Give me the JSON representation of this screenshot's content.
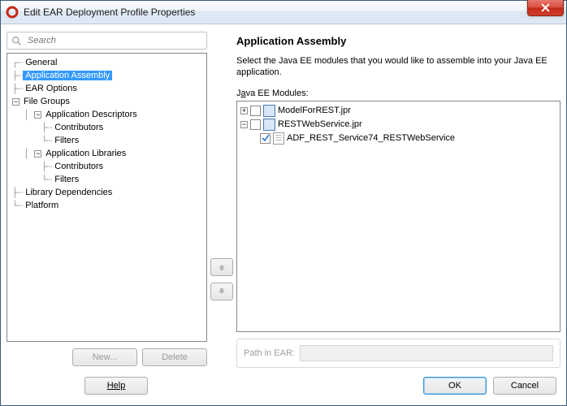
{
  "window": {
    "title": "Edit EAR Deployment Profile Properties"
  },
  "search": {
    "placeholder": "Search"
  },
  "tree": {
    "general": "General",
    "app_assembly": "Application Assembly",
    "ear_options": "EAR Options",
    "file_groups": "File Groups",
    "app_descriptors": "Application Descriptors",
    "contributors": "Contributors",
    "filters": "Filters",
    "app_libraries": "Application Libraries",
    "library_deps": "Library Dependencies",
    "platform": "Platform"
  },
  "left_buttons": {
    "new": "New...",
    "delete": "Delete"
  },
  "right": {
    "heading": "Application Assembly",
    "description": "Select the Java EE modules that you would like to assemble into your Java EE application.",
    "modules_label_pre": "J",
    "modules_label_ul": "a",
    "modules_label_post": "va EE Modules:",
    "modules": {
      "model": "ModelForREST.jpr",
      "rest": "RESTWebService.jpr",
      "child": "ADF_REST_Service74_RESTWebService"
    },
    "path_label": "Path in EAR:",
    "path_value": ""
  },
  "footer": {
    "help": "Help",
    "ok": "OK",
    "cancel": "Cancel"
  }
}
